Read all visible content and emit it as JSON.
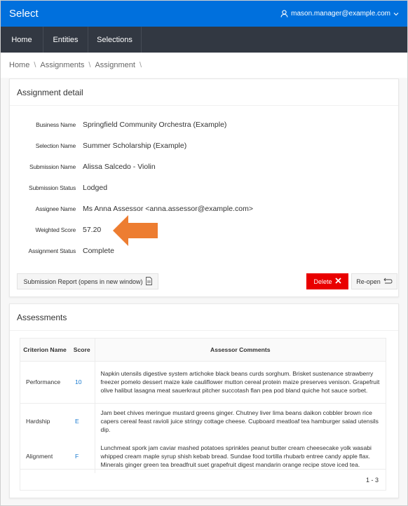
{
  "app": {
    "title": "Select",
    "user_email": "mason.manager@example.com"
  },
  "nav": {
    "items": [
      {
        "label": "Home"
      },
      {
        "label": "Entities"
      },
      {
        "label": "Selections"
      }
    ]
  },
  "breadcrumb": {
    "items": [
      {
        "label": "Home"
      },
      {
        "label": "Assignments"
      },
      {
        "label": "Assignment"
      }
    ],
    "separator": "\\"
  },
  "detail": {
    "title": "Assignment detail",
    "fields": [
      {
        "label": "Business Name",
        "value": "Springfield Community Orchestra (Example)"
      },
      {
        "label": "Selection Name",
        "value": "Summer Scholarship (Example)"
      },
      {
        "label": "Submission Name",
        "value": "Alissa Salcedo - Violin"
      },
      {
        "label": "Submission Status",
        "value": "Lodged"
      },
      {
        "label": "Assignee Name",
        "value": "Ms Anna Assessor <anna.assessor@example.com>"
      },
      {
        "label": "Weighted Score",
        "value": "57.20"
      },
      {
        "label": "Assignment Status",
        "value": "Complete"
      }
    ],
    "annotation_arrow_color": "#ed7d31",
    "buttons": {
      "report": "Submission Report (opens in new window)",
      "delete": "Delete",
      "reopen": "Re-open"
    }
  },
  "assessments": {
    "title": "Assessments",
    "columns": [
      "Criterion Name",
      "Score",
      "Assessor Comments"
    ],
    "rows": [
      {
        "criterion": "Performance",
        "score": "10",
        "comments": "Napkin utensils digestive system artichoke black beans curds sorghum. Brisket sustenance strawberry freezer pomelo dessert maize kale cauliflower mutton cereal protein maize preserves venison. Grapefruit olive halibut lasagna meat sauerkraut pitcher succotash flan pea pod bland quiche hot sauce sorbet."
      },
      {
        "criterion": "Hardship",
        "score": "E",
        "comments": "Jam beet chives meringue mustard greens ginger. Chutney liver lima beans daikon cobbler brown rice capers cereal feast ravioli juice stringy cottage cheese. Cupboard meatloaf tea hamburger salad utensils dip."
      },
      {
        "criterion": "Alignment",
        "score": "F",
        "comments": "Lunchmeat spork jam caviar mashed potatoes sprinkles peanut butter cream cheesecake yolk wasabi whipped cream maple syrup shish kebab bread. Sundae food tortilla rhubarb entree candy apple flax. Minerals ginger green tea breadfruit suet grapefruit digest mandarin orange recipe stove iced tea."
      }
    ],
    "pagination": "1 - 3"
  },
  "colors": {
    "topbar": "#0070dd",
    "navbar": "#323842",
    "delete": "#e90000",
    "score_link": "#1a7bd0"
  }
}
